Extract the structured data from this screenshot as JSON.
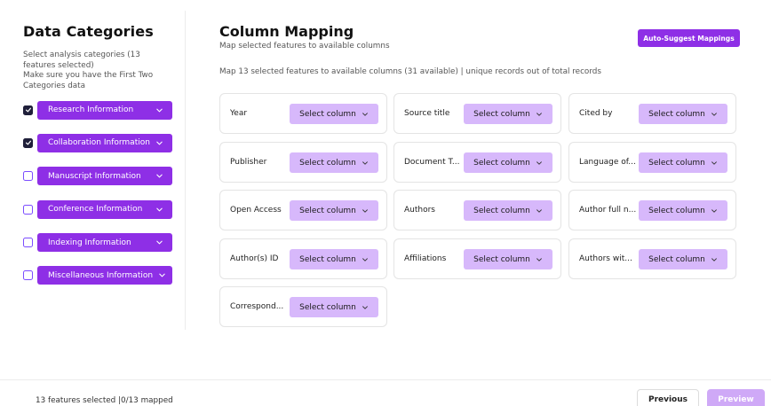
{
  "sidebar": {
    "title": "Data Categories",
    "description_line1": "Select analysis categories (13 features selected)",
    "description_line2": "Make sure you have the First Two Categories data",
    "categories": [
      {
        "label": "Research Information",
        "checked": true,
        "icon": "chevron-down-icon"
      },
      {
        "label": "Collaboration Information",
        "checked": true,
        "icon": "chevron-down-icon"
      },
      {
        "label": "Manuscript Information",
        "checked": false,
        "icon": "chevron-down-icon"
      },
      {
        "label": "Conference Information",
        "checked": false,
        "icon": "chevron-down-icon"
      },
      {
        "label": "Indexing Information",
        "checked": false,
        "icon": "chevron-down-icon"
      },
      {
        "label": "Miscellaneous Information",
        "checked": false,
        "icon": "chevron-down-icon"
      }
    ]
  },
  "main": {
    "title": "Column Mapping",
    "subtitle": "Map selected features to available columns",
    "auto_suggest_label": "Auto-Suggest Mappings",
    "info": "Map 13 selected features to available columns (31 available) | unique records out of total records",
    "select_placeholder": "Select column",
    "fields": [
      {
        "label": "Year"
      },
      {
        "label": "Source title"
      },
      {
        "label": "Cited by"
      },
      {
        "label": "Publisher"
      },
      {
        "label": "Document T..."
      },
      {
        "label": "Language of..."
      },
      {
        "label": "Open Access"
      },
      {
        "label": "Authors"
      },
      {
        "label": "Author full n..."
      },
      {
        "label": "Author(s) ID"
      },
      {
        "label": "Affiliations"
      },
      {
        "label": "Authors wit..."
      },
      {
        "label": "Correspond..."
      }
    ]
  },
  "footer": {
    "status": "13 features selected |0/13 mapped",
    "previous_label": "Previous",
    "preview_label": "Preview"
  },
  "colors": {
    "accent": "#8e2fe6",
    "select_bg": "#d7b8fb",
    "preview_disabled": "#cfa9f7",
    "checkbox_checked": "#1f1f3a"
  }
}
